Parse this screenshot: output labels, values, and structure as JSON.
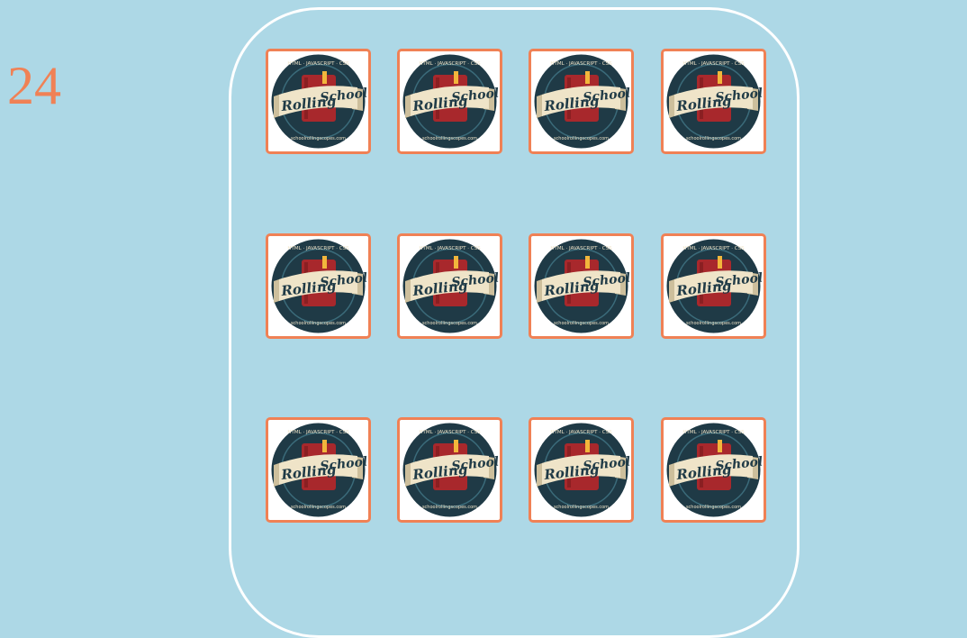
{
  "game": {
    "counter": "24"
  },
  "logo": {
    "top_text": "HTML · JAVASCRIPT · CSS",
    "title_left": "Rolling",
    "title_right": "School",
    "bottom_text": "schoolrollingscopes.com"
  },
  "colors": {
    "background": "#add8e6",
    "board_border": "#ffffff",
    "card_border": "#f08155",
    "counter": "#f08155",
    "logo_ring": "#1f3a46",
    "logo_book": "#a8282c",
    "logo_ribbon": "#efe4c8",
    "logo_text": "#1f3a46"
  },
  "cards": [
    {
      "id": "1",
      "state": "face-down"
    },
    {
      "id": "2",
      "state": "face-down"
    },
    {
      "id": "3",
      "state": "face-down"
    },
    {
      "id": "4",
      "state": "face-down"
    },
    {
      "id": "5",
      "state": "face-down"
    },
    {
      "id": "6",
      "state": "face-down"
    },
    {
      "id": "7",
      "state": "face-down"
    },
    {
      "id": "8",
      "state": "face-down"
    },
    {
      "id": "9",
      "state": "face-down"
    },
    {
      "id": "10",
      "state": "face-down"
    },
    {
      "id": "11",
      "state": "face-down"
    },
    {
      "id": "12",
      "state": "face-down"
    }
  ]
}
